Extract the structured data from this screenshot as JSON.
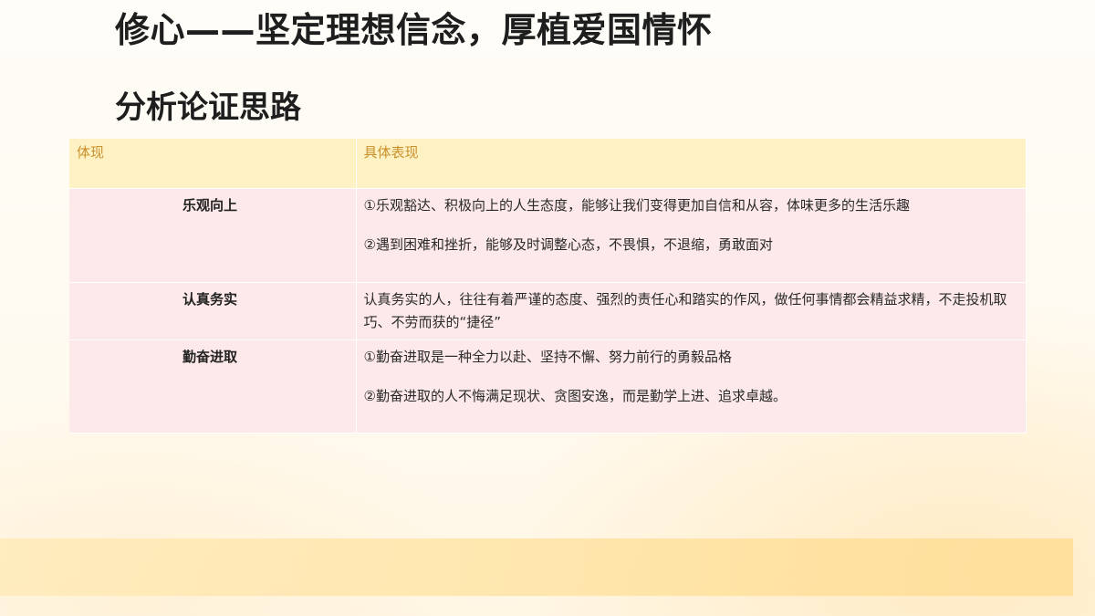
{
  "slide": {
    "title": "修心——坚定理想信念，厚植爱国情怀",
    "subtitle": "分析论证思路"
  },
  "table": {
    "headers": [
      "体现",
      "具体表现"
    ],
    "rows": [
      {
        "label": "乐观向上",
        "details": [
          "①乐观豁达、积极向上的人生态度，能够让我们变得更加自信和从容，体味更多的生活乐趣",
          "②遇到困难和挫折，能够及时调整心态，不畏惧，不退缩，勇敢面对"
        ]
      },
      {
        "label": "认真务实",
        "details": [
          "认真务实的人，往往有着严谨的态度、强烈的责任心和踏实的作风，做任何事情都会精益求精，不走投机取巧、不劳而获的“捷径”"
        ]
      },
      {
        "label": "勤奋进取",
        "details": [
          "①勤奋进取是一种全力以赴、坚持不懈、努力前行的勇毅品格",
          "②勤奋进取的人不悔满足现状、贪图安逸，而是勤学上进、追求卓越。"
        ]
      }
    ]
  },
  "colors": {
    "header_bg": "#fef2c4",
    "header_text": "#c9902a",
    "row_bg": "#fde9e9",
    "bottom_band": "#ffe2a0"
  }
}
